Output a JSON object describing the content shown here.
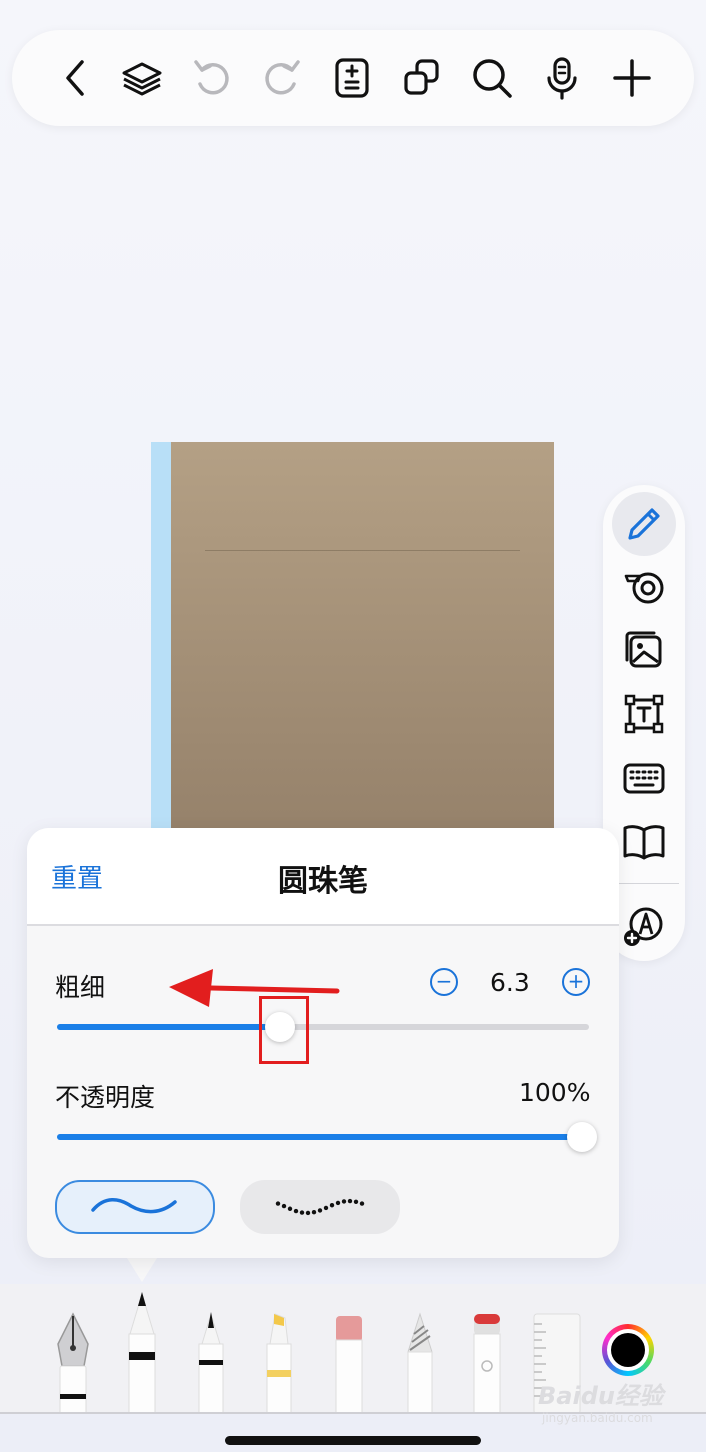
{
  "toolbar": {
    "icons": [
      "back-icon",
      "layers-icon",
      "undo-icon",
      "redo-icon",
      "page-adjust-icon",
      "duplicate-icon",
      "search-icon",
      "microphone-icon",
      "add-icon"
    ]
  },
  "side_panel": {
    "icons": [
      "pencil-icon",
      "tape-icon",
      "image-icon",
      "textbox-icon",
      "keyboard-icon",
      "book-icon",
      "add-tool-icon"
    ],
    "active_color": "#1a73d9"
  },
  "popover": {
    "reset_label": "重置",
    "title": "圆珠笔",
    "thickness": {
      "label": "粗细",
      "value": "6.3",
      "level": 0.42
    },
    "opacity": {
      "label": "不透明度",
      "value": "100%",
      "level": 1.0
    },
    "stroke_styles": [
      "smooth",
      "dotted"
    ],
    "selected_stroke": "smooth",
    "accent_color": "#1a73d9"
  },
  "tools": [
    "fountain-pen",
    "ballpoint-pen",
    "fineliner",
    "highlighter",
    "eraser",
    "pencil",
    "tape-eraser",
    "ruler",
    "color-picker"
  ],
  "selected_tool": "ballpoint-pen",
  "selected_color": "#000000",
  "watermark": {
    "brand": "Baidu",
    "suffix": "经验",
    "site": "jingyan.baidu.com"
  }
}
